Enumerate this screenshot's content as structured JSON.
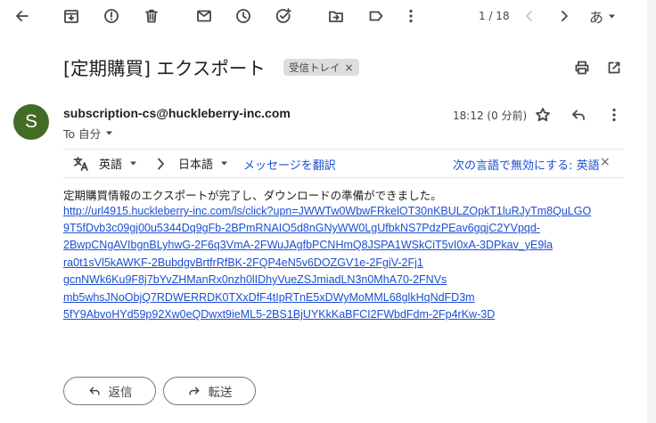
{
  "toolbar": {
    "page_counter": "1 / 18",
    "input_method_label": "あ",
    "icons": [
      "back-arrow-icon",
      "archive-icon",
      "report-spam-icon",
      "delete-icon",
      "mark-unread-icon",
      "snooze-icon",
      "add-task-icon",
      "move-to-icon",
      "label-icon",
      "more-vert-icon",
      "chevron-left-icon",
      "chevron-right-icon"
    ]
  },
  "message": {
    "subject": "[定期購買] エクスポート",
    "label_chip": "受信トレイ",
    "label_chip_close": "×",
    "avatar_letter": "S",
    "avatar_color": "#426c24",
    "sender": "subscription-cs@huckleberry-inc.com",
    "to_line": "To 自分",
    "timestamp": "18:12 (0 分前)"
  },
  "translate_bar": {
    "source_language": "英語",
    "target_language": "日本語",
    "translate_link": "メッセージを翻訳",
    "disable_link": "次の言語で無効にする: 英語",
    "close_label": "×"
  },
  "body": {
    "text": "定期購買情報のエクスポートが完了し、ダウンロードの準備ができました。",
    "link_lines": [
      "http://url4915.huckleberry-inc.com/ls/click?upn=JWWTw0WbwFRkelOT30nKBULZOpkT1luRJyTm8QuLGO",
      "9T5fDvb3c09gj00u5344Dq9gFb-2BPmRNAIO5d8nGNyWW0LgUfbkNS7PdzPEav6gqjC2YVpqd-",
      "2BwpCNgAVIbgnBLyhwG-2F6q3VmA-2FWuJAgfbPCNHmQ8JSPA1WSkCiT5vI0xA-3DPkav_yE9la",
      "ra0t1sVl5kAWKF-2BubdgvBrtfrRfBK-2FQP4eN5v6DOZGV1e-2FgiV-2Fj1",
      "gcnNWk6Ku9F8j7bYvZHManRx0nzh0lIDhyVueZSJmiadLN3n0MhA70-2FNVs",
      "mb5whsJNoObjQ7RDWERRDK0TXxDfF4tIpRTnE5xDWyMoMML68glkHqNdFD3m",
      "5fY9AbvoHYd59p92Xw0eQDwxt9ieML5-2BS1BjUYKkKaBFCI2FWbdFdm-2Fp4rKw-3D"
    ]
  },
  "actions": {
    "reply_label": "返信",
    "forward_label": "転送"
  }
}
